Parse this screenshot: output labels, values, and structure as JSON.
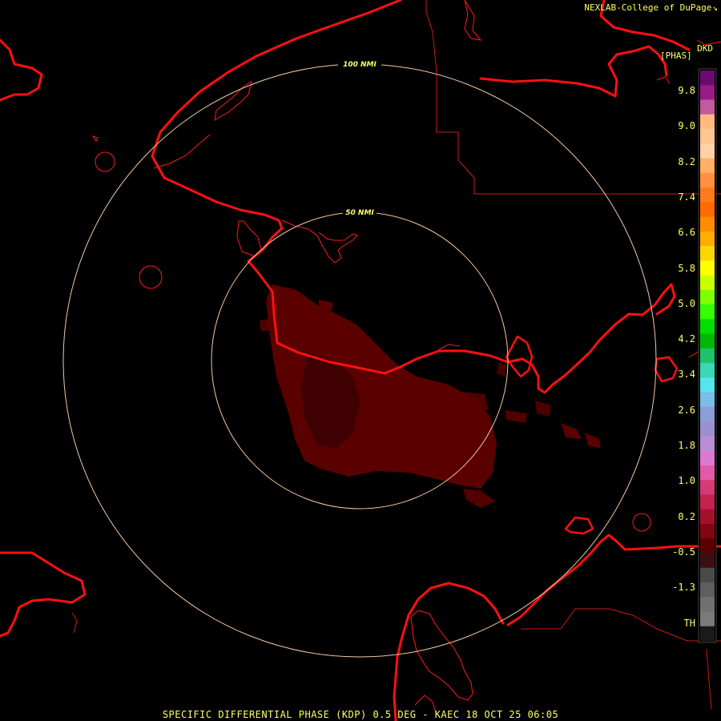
{
  "credit": "NEXLAB-College of DuPage",
  "credit_icon": "resize-arrow-icon",
  "product_code": "DKD",
  "units": "[PHAS]",
  "range_rings": [
    {
      "label": "100 NMI",
      "range_nmi": 100
    },
    {
      "label": "50 NMI",
      "range_nmi": 50
    }
  ],
  "scale_labels": [
    "9.8",
    "9.0",
    "8.2",
    "7.4",
    "6.6",
    "5.8",
    "5.0",
    "4.2",
    "3.4",
    "2.6",
    "1.8",
    "1.0",
    "0.2",
    "-0.5",
    "-1.3",
    "TH"
  ],
  "color_scale": [
    "#6b0a73",
    "#9a1b86",
    "#c25a9d",
    "#ffbb7f",
    "#ffc592",
    "#ffd1a6",
    "#ffb066",
    "#ff9140",
    "#ff7a1c",
    "#ff6a00",
    "#ff8c00",
    "#ffae00",
    "#ffd700",
    "#ffff00",
    "#ccff00",
    "#7fff00",
    "#33ff00",
    "#00e000",
    "#00b800",
    "#1fc26b",
    "#38d9b4",
    "#56e6ea",
    "#7bbde6",
    "#8d9ed6",
    "#9b8fcf",
    "#b98ed4",
    "#d97ad0",
    "#e45aa8",
    "#d63a76",
    "#c4224f",
    "#a4112a",
    "#820612",
    "#5a0000",
    "#3c1010",
    "#4a4a4a",
    "#5e5e5e",
    "#707070",
    "#7a7a7a",
    "#1a1a1a"
  ],
  "footer": "SPECIFIC DIFFERENTIAL PHASE (KDP) 0.5 DEG - KAEC 18 OCT 25 06:05",
  "colors": {
    "coastline": "#ff1010",
    "boundary": "#d01818",
    "range_ring": "#f2c9a0",
    "label_text": "#ffff66",
    "echo": "#5a0000",
    "background": "#000000"
  }
}
